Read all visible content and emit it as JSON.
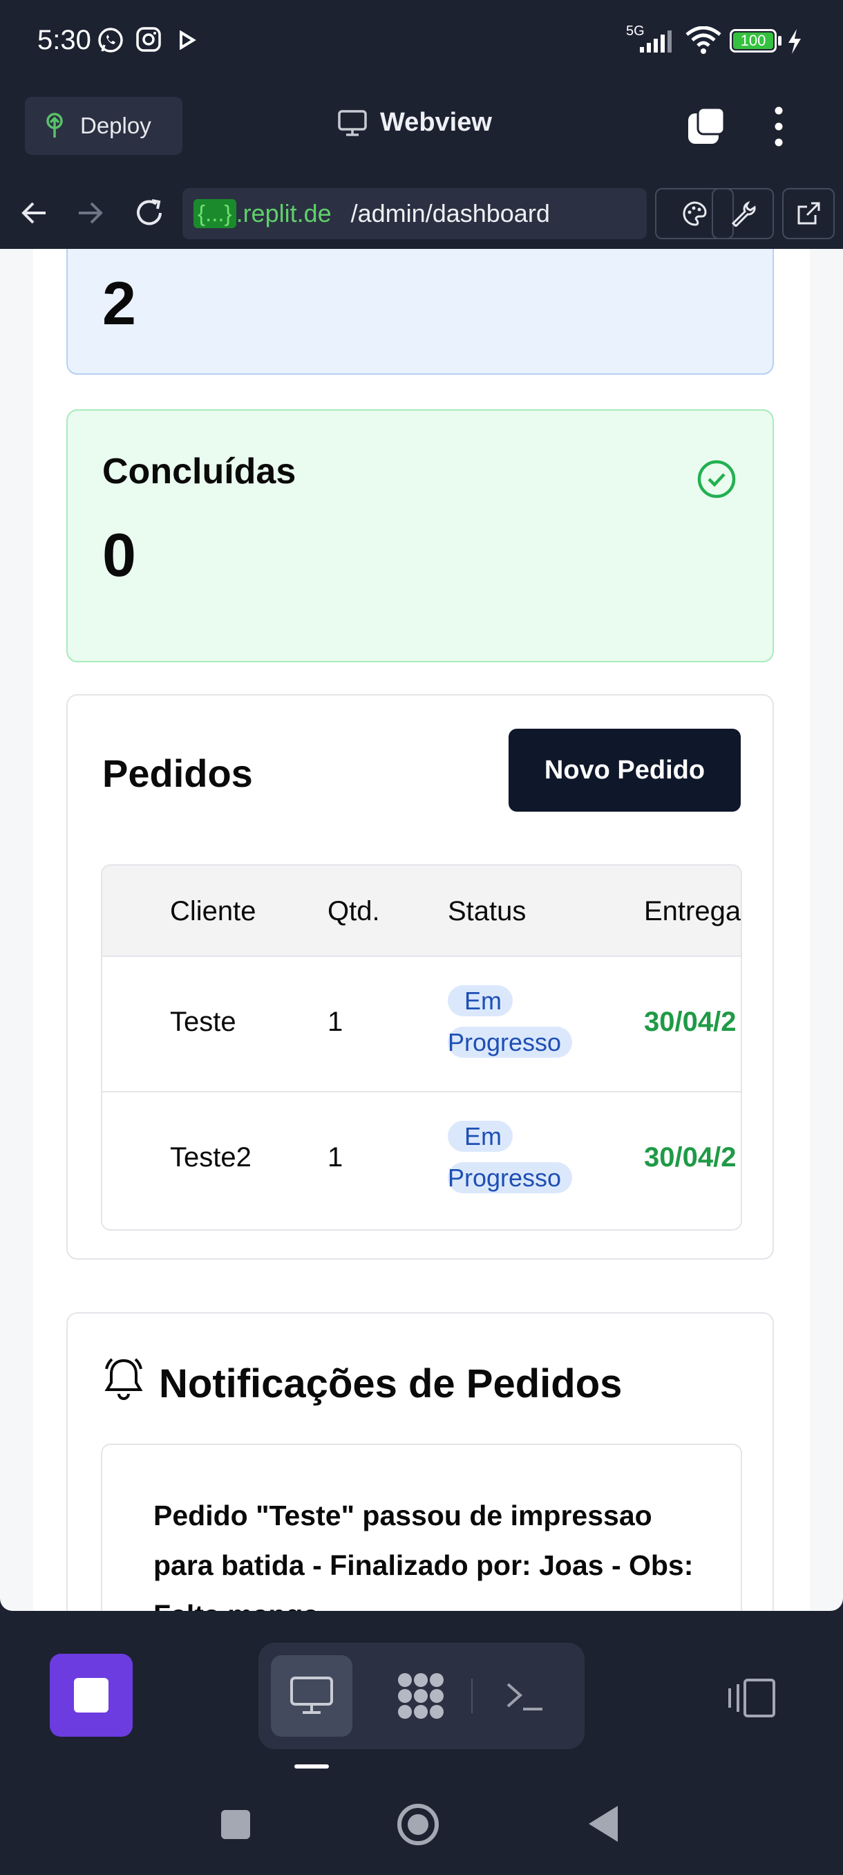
{
  "status_bar": {
    "time": "5:30",
    "network": "5G",
    "battery": "100",
    "icons": [
      "whatsapp-icon",
      "instagram-icon",
      "play-icon",
      "signal-icon",
      "wifi-icon",
      "battery-icon",
      "charging-icon"
    ]
  },
  "app_header": {
    "deploy_label": "Deploy",
    "title": "Webview"
  },
  "url_bar": {
    "braces": "{...}",
    "domain": ".replit.de",
    "path": "/admin/dashboard"
  },
  "stats": {
    "pending": {
      "value": "2"
    },
    "done": {
      "label": "Concluídas",
      "value": "0"
    }
  },
  "orders": {
    "title": "Pedidos",
    "new_button": "Novo Pedido",
    "columns": [
      "Cliente",
      "Qtd.",
      "Status",
      "Entrega"
    ],
    "rows": [
      {
        "cliente": "Teste",
        "qtd": "1",
        "status_l1": "Em",
        "status_l2": "Progresso",
        "entrega": "30/04/2"
      },
      {
        "cliente": "Teste2",
        "qtd": "1",
        "status_l1": "Em",
        "status_l2": "Progresso",
        "entrega": "30/04/2"
      }
    ]
  },
  "notifications": {
    "title": "Notificações de Pedidos",
    "items": [
      {
        "text": "Pedido \"Teste\" passou de impressao para batida - Finalizado por: Joas - Obs: Falta manga"
      }
    ]
  },
  "colors": {
    "bg_dark": "#1d2231",
    "accent_purple": "#6c3ce0",
    "done_green": "#1f9a46",
    "status_blue": "#1e4fb4",
    "url_green": "#5fd16a"
  }
}
